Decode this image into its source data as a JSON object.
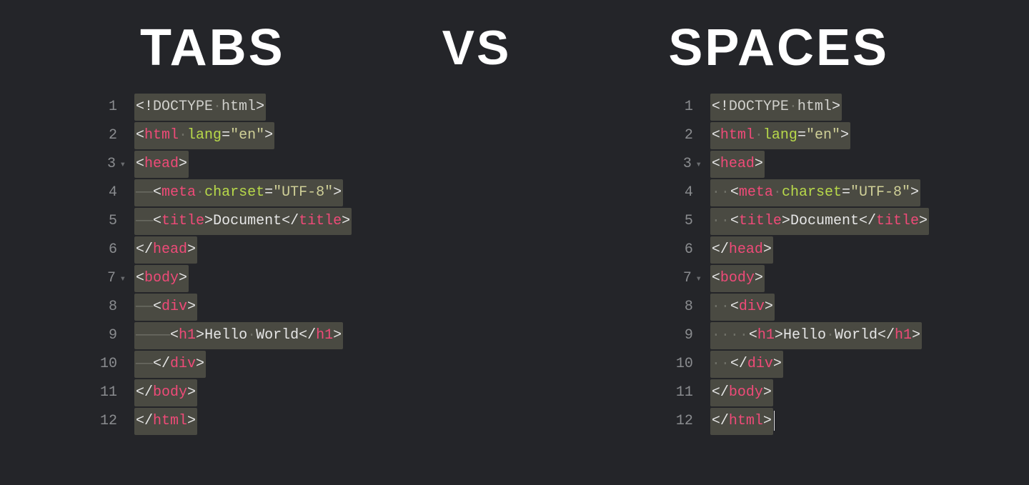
{
  "titles": {
    "left": "TABS",
    "vs": "VS",
    "right": "SPACES"
  },
  "lineNumbers": [
    "1",
    "2",
    "3",
    "4",
    "5",
    "6",
    "7",
    "8",
    "9",
    "10",
    "11",
    "12"
  ],
  "foldLines": [
    3,
    7
  ],
  "code": {
    "l1": {
      "doctype": "DOCTYPE",
      "html": "html"
    },
    "l2": {
      "tag": "html",
      "attr": "lang",
      "val": "\"en\""
    },
    "l3": {
      "tag": "head"
    },
    "l4": {
      "tag": "meta",
      "attr": "charset",
      "val": "\"UTF-8\""
    },
    "l5": {
      "tag": "title",
      "text": "Document"
    },
    "l6": {
      "tag": "head"
    },
    "l7": {
      "tag": "body"
    },
    "l8": {
      "tag": "div"
    },
    "l9": {
      "tag": "h1",
      "text": "Hello",
      "text2": "World"
    },
    "l10": {
      "tag": "div"
    },
    "l11": {
      "tag": "body"
    },
    "l12": {
      "tag": "html"
    }
  },
  "indent": {
    "tab1": "——",
    "tab2": "————",
    "sp1": "··",
    "sp2": "····"
  }
}
